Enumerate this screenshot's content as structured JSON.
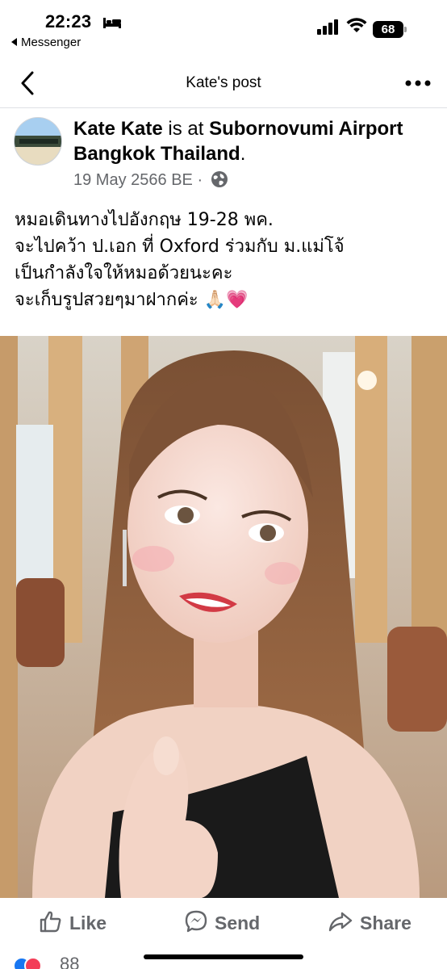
{
  "status_bar": {
    "time": "22:23",
    "back_app": "Messenger",
    "battery": "68",
    "icons": [
      "bed-icon",
      "cellular-signal-icon",
      "wifi-icon",
      "battery-icon"
    ]
  },
  "nav": {
    "title": "Kate's post",
    "icons": [
      "chevron-left-icon",
      "more-horizontal-icon"
    ]
  },
  "post": {
    "author": "Kate Kate",
    "connector": " is at ",
    "place": "Subornovumi Airport Bangkok Thailand",
    "place_end": ".",
    "date": "19 May 2566 BE",
    "separator": "·",
    "audience_icon": "globe-icon",
    "text_lines": [
      "หมอเดินทางไปอังกฤษ 19-28 พค.",
      "จะไปคว้า ป.เอก ที่ Oxford  ร่วมกับ ม.แม่โจ้",
      "เป็นกำลังใจให้หมอด้วยนะคะ",
      "จะเก็บรูปสวยๆมาฝากค่ะ 🙏🏻💗"
    ]
  },
  "actions": {
    "like": "Like",
    "send": "Send",
    "share": "Share"
  },
  "reactions": {
    "types": [
      "like",
      "love"
    ],
    "count": "88"
  },
  "colors": {
    "secondary_text": "#65676b",
    "divider": "#dfe1e5",
    "like_blue": "#1877f2",
    "love_red": "#f33e58"
  }
}
